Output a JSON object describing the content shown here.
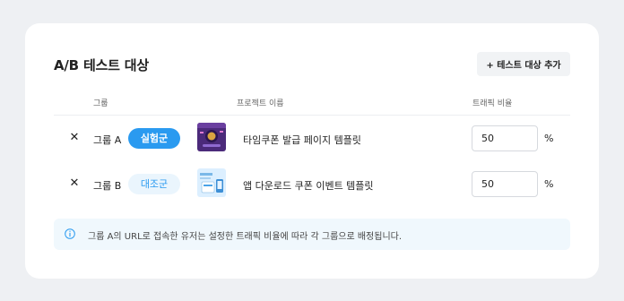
{
  "panel": {
    "title": "A/B 테스트 대상",
    "add_button_label": "+ 테스트 대상 추가"
  },
  "table": {
    "columns": [
      "그룹",
      "프로젝트 이름",
      "트래픽 비율"
    ],
    "rows": [
      {
        "remove_icon": "✕",
        "group": "그룹 A",
        "badge": "실험군",
        "thumbnail_icon": "timed-coupon-template-thumbnail",
        "project": "타임쿠폰 발급 페이지 템플릿",
        "traffic": "50",
        "unit": "%"
      },
      {
        "remove_icon": "✕",
        "group": "그룹 B",
        "badge": "대조군",
        "thumbnail_icon": "app-download-coupon-template-thumbnail",
        "project": "앱 다운로드 쿠폰 이벤트 템플릿",
        "traffic": "50",
        "unit": "%"
      }
    ]
  },
  "notice": {
    "icon": "info-icon",
    "text": "그룹 A의 URL로 접속한 유저는 설정한 트래픽 비율에 따라 각 그룹으로 배정됩니다."
  },
  "colors": {
    "accent": "#2a9af0",
    "badge_secondary_bg": "#eaf5fd",
    "notice_bg": "#f0f8fd",
    "page_bg": "#eef0f3"
  }
}
